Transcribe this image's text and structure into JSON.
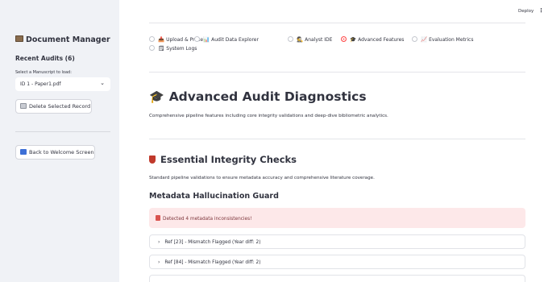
{
  "sidebar": {
    "title": "Document Manager",
    "recent_audits": "Recent Audits (6)",
    "select_label": "Select a Manuscript to load:",
    "selected_manuscript": "ID 1 - Paper1.pdf",
    "delete_button": "Delete Selected Record",
    "back_button": "Back to Welcome Screen"
  },
  "toolbar": {
    "deploy": "Deploy",
    "menu": "⋮"
  },
  "nav": {
    "items": [
      {
        "label": "Upload & Process",
        "icon": "inbox-tray-icon",
        "active": false
      },
      {
        "label": "Audit Data Explorer",
        "icon": "bar-chart-icon",
        "active": false
      },
      {
        "label": "Analyst IDE",
        "icon": "detective-icon",
        "active": false
      },
      {
        "label": "Advanced Features",
        "icon": "graduation-cap-icon",
        "active": true
      },
      {
        "label": "Evaluation Metrics",
        "icon": "chart-increasing-icon",
        "active": false
      },
      {
        "label": "System Logs",
        "icon": "notepad-icon",
        "active": false
      }
    ]
  },
  "main": {
    "title": "Advanced Audit Diagnostics",
    "subtitle": "Comprehensive pipeline features including core integrity validations and deep-dive bibliometric analytics.",
    "section_title": "Essential Integrity Checks",
    "section_desc": "Standard pipeline validations to ensure metadata accuracy and comprehensive literature coverage.",
    "subsection_title": "Metadata Hallucination Guard",
    "alert": "Detected 4 metadata inconsistencies!",
    "expanders": [
      "Ref [23] - Mismatch Flagged (Year diff: 2)",
      "Ref [84] - Mismatch Flagged (Year diff: 2)"
    ]
  },
  "colors": {
    "accent": "#ff4b4b",
    "sidebar_bg": "#f0f2f6",
    "alert_bg": "#fde8e9",
    "alert_text": "#7d353b"
  }
}
